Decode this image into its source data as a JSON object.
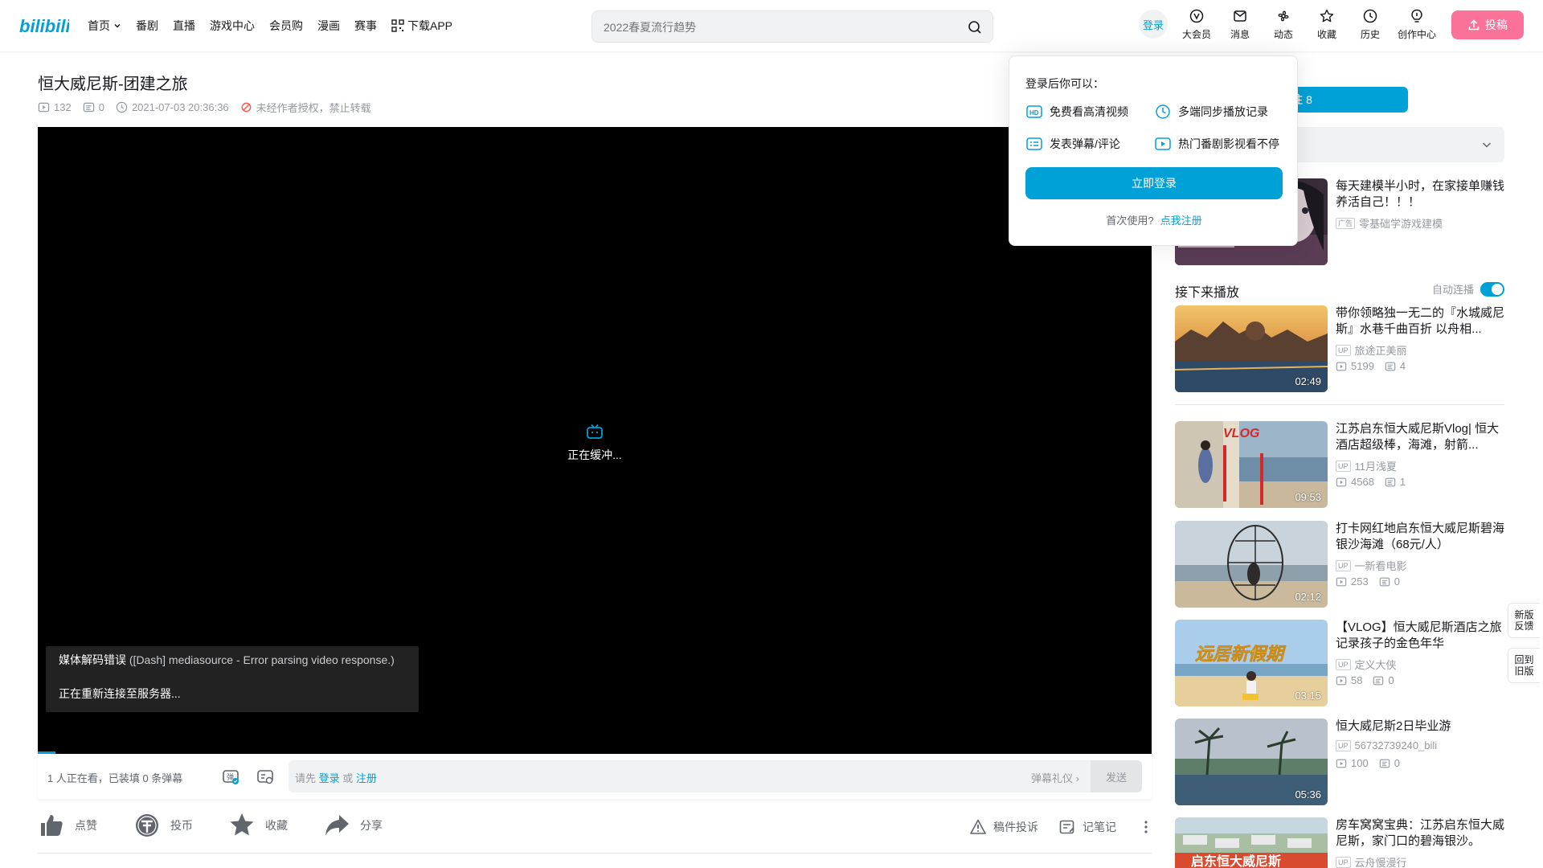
{
  "header": {
    "logo": "bilibili",
    "nav": [
      {
        "label": "首页",
        "dropdown": true
      },
      {
        "label": "番剧"
      },
      {
        "label": "直播"
      },
      {
        "label": "游戏中心"
      },
      {
        "label": "会员购"
      },
      {
        "label": "漫画"
      },
      {
        "label": "赛事"
      },
      {
        "label": "下载APP",
        "icon": "qrcode-icon"
      }
    ],
    "search_placeholder": "2022春夏流行趋势",
    "login_label": "登录",
    "right_entries": [
      {
        "label": "大会员",
        "icon": "vip-icon"
      },
      {
        "label": "消息",
        "icon": "message-icon"
      },
      {
        "label": "动态",
        "icon": "dynamic-icon"
      },
      {
        "label": "收藏",
        "icon": "favorite-icon"
      },
      {
        "label": "历史",
        "icon": "history-icon"
      },
      {
        "label": "创作中心",
        "icon": "creator-icon"
      }
    ],
    "upload_label": "投稿"
  },
  "video": {
    "title": "恒大威尼斯-团建之旅",
    "views": "132",
    "danmaku_count": "0",
    "pubdate": "2021-07-03 20:36:36",
    "copyright": "未经作者授权，禁止转载"
  },
  "player": {
    "buffering": "正在缓冲...",
    "error_title": "媒体解码错误",
    "error_detail": "([Dash] mediasource - Error parsing video response.)",
    "error_reconnect": "正在重新连接至服务器..."
  },
  "sendbar": {
    "viewers": "1 人正在看，已装填 0 条弹幕",
    "placeholder_prefix": "请先",
    "login": "登录",
    "or": "或",
    "register": "注册",
    "etiquette": "弹幕礼仪",
    "send": "发送"
  },
  "actions": {
    "like": "点赞",
    "coin": "投币",
    "favorite": "收藏",
    "share": "分享",
    "report": "稿件投诉",
    "notes": "记笔记"
  },
  "sidebar": {
    "follow": "+ 关注 8",
    "next_title": "接下来播放",
    "autoplay": "自动连播"
  },
  "ad": {
    "title": "每天建模半小时，在家接单赚钱养活自己！！！",
    "badge": "广告",
    "source": "零基础学游戏建模"
  },
  "recommendations": [
    {
      "title": "带你领略独一无二的『水城威尼斯』水巷千曲百折 以舟相...",
      "up": "旅途正美丽",
      "views": "5199",
      "danmaku": "4",
      "duration": "02:49"
    },
    {
      "title": "江苏启东恒大威尼斯Vlog| 恒大酒店超级棒，海滩，射箭...",
      "up": "11月浅夏",
      "views": "4568",
      "danmaku": "1",
      "duration": "09:53"
    },
    {
      "title": "打卡网红地启东恒大威尼斯碧海银沙海滩（68元/人）",
      "up": "一新看电影",
      "views": "253",
      "danmaku": "0",
      "duration": "02:12"
    },
    {
      "title": "【VLOG】恒大威尼斯酒店之旅 记录孩子的金色年华",
      "up": "定义大侠",
      "views": "58",
      "danmaku": "0",
      "duration": "03:15"
    },
    {
      "title": "恒大威尼斯2日毕业游",
      "up": "56732739240_bili",
      "views": "100",
      "danmaku": "0",
      "duration": "05:36"
    },
    {
      "title": "房车窝窝宝典：江苏启东恒大威尼斯，家门口的碧海银沙。",
      "up": "云舟慢漫行",
      "views": "",
      "danmaku": "",
      "duration": ""
    }
  ],
  "side_buttons": {
    "feedback": "新版反馈",
    "back_old": "回到旧版"
  },
  "login_popup": {
    "title": "登录后你可以：",
    "perks": [
      "免费看高清视频",
      "多端同步播放记录",
      "发表弹幕/评论",
      "热门番剧影视看不停"
    ],
    "button": "立即登录",
    "first_time": "首次使用?",
    "register": "点我注册"
  },
  "colors": {
    "brand_blue": "#00a1d6",
    "brand_pink": "#fb7299"
  }
}
